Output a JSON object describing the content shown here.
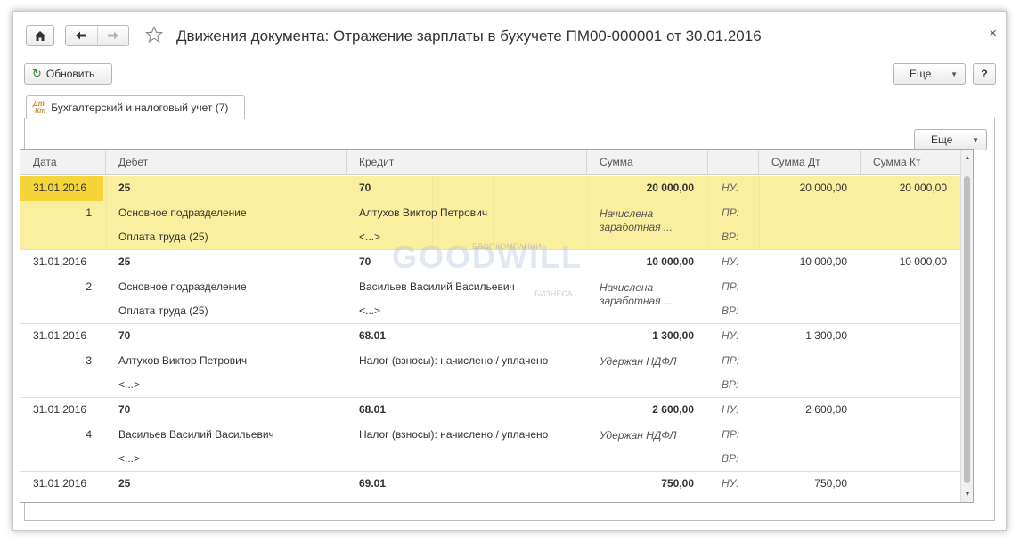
{
  "window": {
    "title": "Движения документа: Отражение зарплаты в бухучете ПМ00-000001 от 30.01.2016",
    "close_label": "×"
  },
  "toolbar": {
    "refresh_label": "Обновить",
    "more_label": "Еще",
    "help_label": "?"
  },
  "tab": {
    "label": "Бухгалтерский и налоговый учет (7)",
    "icon_text": "Дт Кт"
  },
  "table_toolbar": {
    "more_label": "Еще"
  },
  "table": {
    "columns": [
      "Дата",
      "Дебет",
      "Кредит",
      "Сумма",
      "",
      "Сумма Дт",
      "Сумма Кт"
    ],
    "rows": [
      {
        "date": "31.01.2016",
        "num": "1",
        "selected": true,
        "debit": [
          "25",
          "Основное подразделение",
          "Оплата труда (25)"
        ],
        "credit": [
          "70",
          "Алтухов Виктор Петрович",
          "<...>"
        ],
        "sum": "20 000,00",
        "desc": "Начислена заработная ...",
        "types": [
          "НУ:",
          "ПР:",
          "ВР:"
        ],
        "sum_dt": "20 000,00",
        "sum_kt": "20 000,00"
      },
      {
        "date": "31.01.2016",
        "num": "2",
        "selected": false,
        "debit": [
          "25",
          "Основное подразделение",
          "Оплата труда (25)"
        ],
        "credit": [
          "70",
          "Васильев Василий Васильевич",
          "<...>"
        ],
        "sum": "10 000,00",
        "desc": "Начислена заработная ...",
        "types": [
          "НУ:",
          "ПР:",
          "ВР:"
        ],
        "sum_dt": "10 000,00",
        "sum_kt": "10 000,00"
      },
      {
        "date": "31.01.2016",
        "num": "3",
        "selected": false,
        "debit": [
          "70",
          "Алтухов Виктор Петрович",
          "<...>"
        ],
        "credit": [
          "68.01",
          "Налог (взносы): начислено / уплачено",
          ""
        ],
        "sum": "1 300,00",
        "desc": "Удержан НДФЛ",
        "types": [
          "НУ:",
          "ПР:",
          "ВР:"
        ],
        "sum_dt": "1 300,00",
        "sum_kt": ""
      },
      {
        "date": "31.01.2016",
        "num": "4",
        "selected": false,
        "debit": [
          "70",
          "Васильев Василий Васильевич",
          "<...>"
        ],
        "credit": [
          "68.01",
          "Налог (взносы): начислено / уплачено",
          ""
        ],
        "sum": "2 600,00",
        "desc": "Удержан НДФЛ",
        "types": [
          "НУ:",
          "ПР:",
          "ВР:"
        ],
        "sum_dt": "2 600,00",
        "sum_kt": ""
      },
      {
        "date": "31.01.2016",
        "num": "",
        "selected": false,
        "debit": [
          "25",
          "",
          ""
        ],
        "credit": [
          "69.01",
          "",
          ""
        ],
        "sum": "750,00",
        "desc": "",
        "types": [
          "НУ:",
          "",
          ""
        ],
        "sum_dt": "750,00",
        "sum_kt": ""
      }
    ]
  },
  "watermark": {
    "main": "GOODWILL",
    "top": "БЛОГ КОМПАНИИ",
    "bottom": "БИЗНЕСА"
  },
  "colors": {
    "selected_row": "#faef9e",
    "selected_date": "#f5d53a",
    "refresh_icon": "#3a8a3a"
  }
}
